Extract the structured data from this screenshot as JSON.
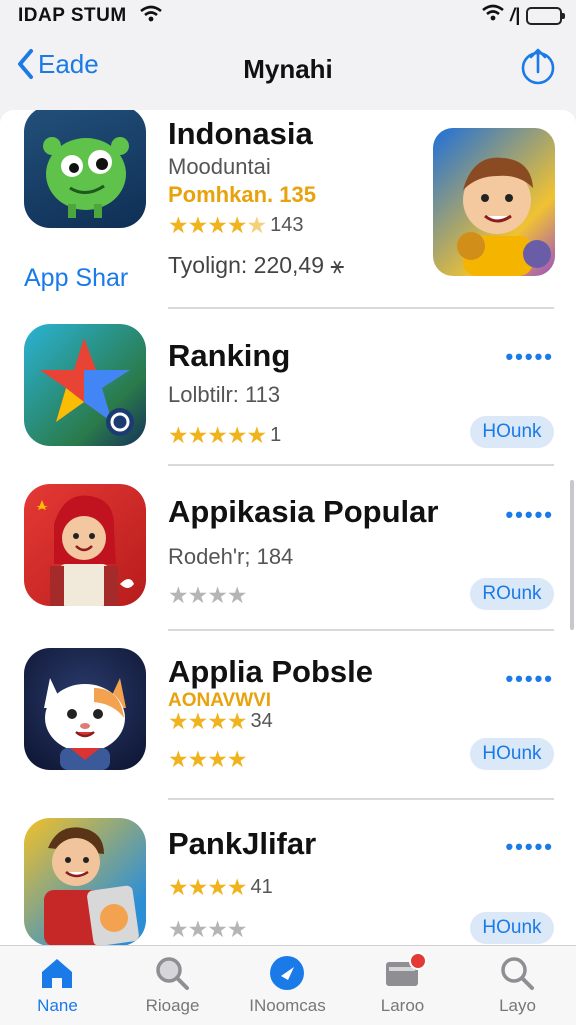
{
  "status_bar": {
    "carrier": "IDAP STUM",
    "signal_glyph": "/|"
  },
  "nav": {
    "back_label": "Eade",
    "title": "Mynahi"
  },
  "side_link": "App Shar",
  "apps": [
    {
      "title": "Indonasia",
      "line1": "Mooduntai",
      "line2": "Pomhkan. 135",
      "rating": 4.5,
      "rating_count": "143",
      "extra": "Tyolign: 220,49 ⚹"
    },
    {
      "title": "Ranking",
      "line1": "Lolbtilr: 113",
      "rating": 5,
      "rating_count": "1",
      "more": "•••••",
      "button": "HOunk"
    },
    {
      "title": "Appikasia Popular",
      "line1": "Rodeh'r; 184",
      "rating": 0,
      "rating_count": "",
      "more": "•••••",
      "button": "ROunk"
    },
    {
      "title": "Applia Pobsle",
      "line1": "AONAVWVI",
      "line1_rating_count": "34",
      "rating": 4,
      "rating_count": "",
      "more": "•••••",
      "button": "HOunk"
    },
    {
      "title": "PankJlifar",
      "rating": 4,
      "rating_count": "41",
      "more": "•••••",
      "button": "HOunk"
    }
  ],
  "tabs": [
    {
      "label": "Nane",
      "icon": "home-icon",
      "active": true
    },
    {
      "label": "Rioage",
      "icon": "search-icon"
    },
    {
      "label": "INoomcas",
      "icon": "compass-icon"
    },
    {
      "label": "Laroo",
      "icon": "folder-icon"
    },
    {
      "label": "Layo",
      "icon": "search-icon"
    }
  ],
  "colors": {
    "accent": "#1a7ae8",
    "star": "#f0b31c",
    "badge": "#e53935",
    "battery": "#34c759"
  }
}
